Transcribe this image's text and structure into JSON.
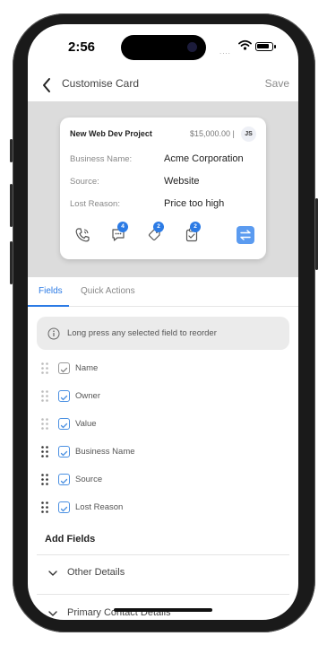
{
  "status": {
    "time": "2:56",
    "signal_dots": "...."
  },
  "nav": {
    "title": "Customise Card",
    "save_label": "Save"
  },
  "card": {
    "title": "New Web Dev Project",
    "amount": "$15,000.00 |",
    "avatar": "JS",
    "rows": [
      {
        "label": "Business Name:",
        "value": "Acme Corporation"
      },
      {
        "label": "Source:",
        "value": "Website"
      },
      {
        "label": "Lost Reason:",
        "value": "Price too high"
      }
    ],
    "badges": {
      "notes": "4",
      "tags": "2",
      "tasks": "2"
    }
  },
  "tabs": [
    {
      "label": "Fields"
    },
    {
      "label": "Quick Actions"
    }
  ],
  "info_text": "Long press any selected field to reorder",
  "fields": [
    {
      "label": "Name"
    },
    {
      "label": "Owner"
    },
    {
      "label": "Value"
    },
    {
      "label": "Business Name"
    },
    {
      "label": "Source"
    },
    {
      "label": "Lost Reason"
    }
  ],
  "add_fields_label": "Add Fields",
  "sections": [
    {
      "label": "Other Details"
    },
    {
      "label": "Primary Contact Details"
    }
  ],
  "colors": {
    "accent": "#2c7be5",
    "preview_bg": "#dcdcdc"
  }
}
